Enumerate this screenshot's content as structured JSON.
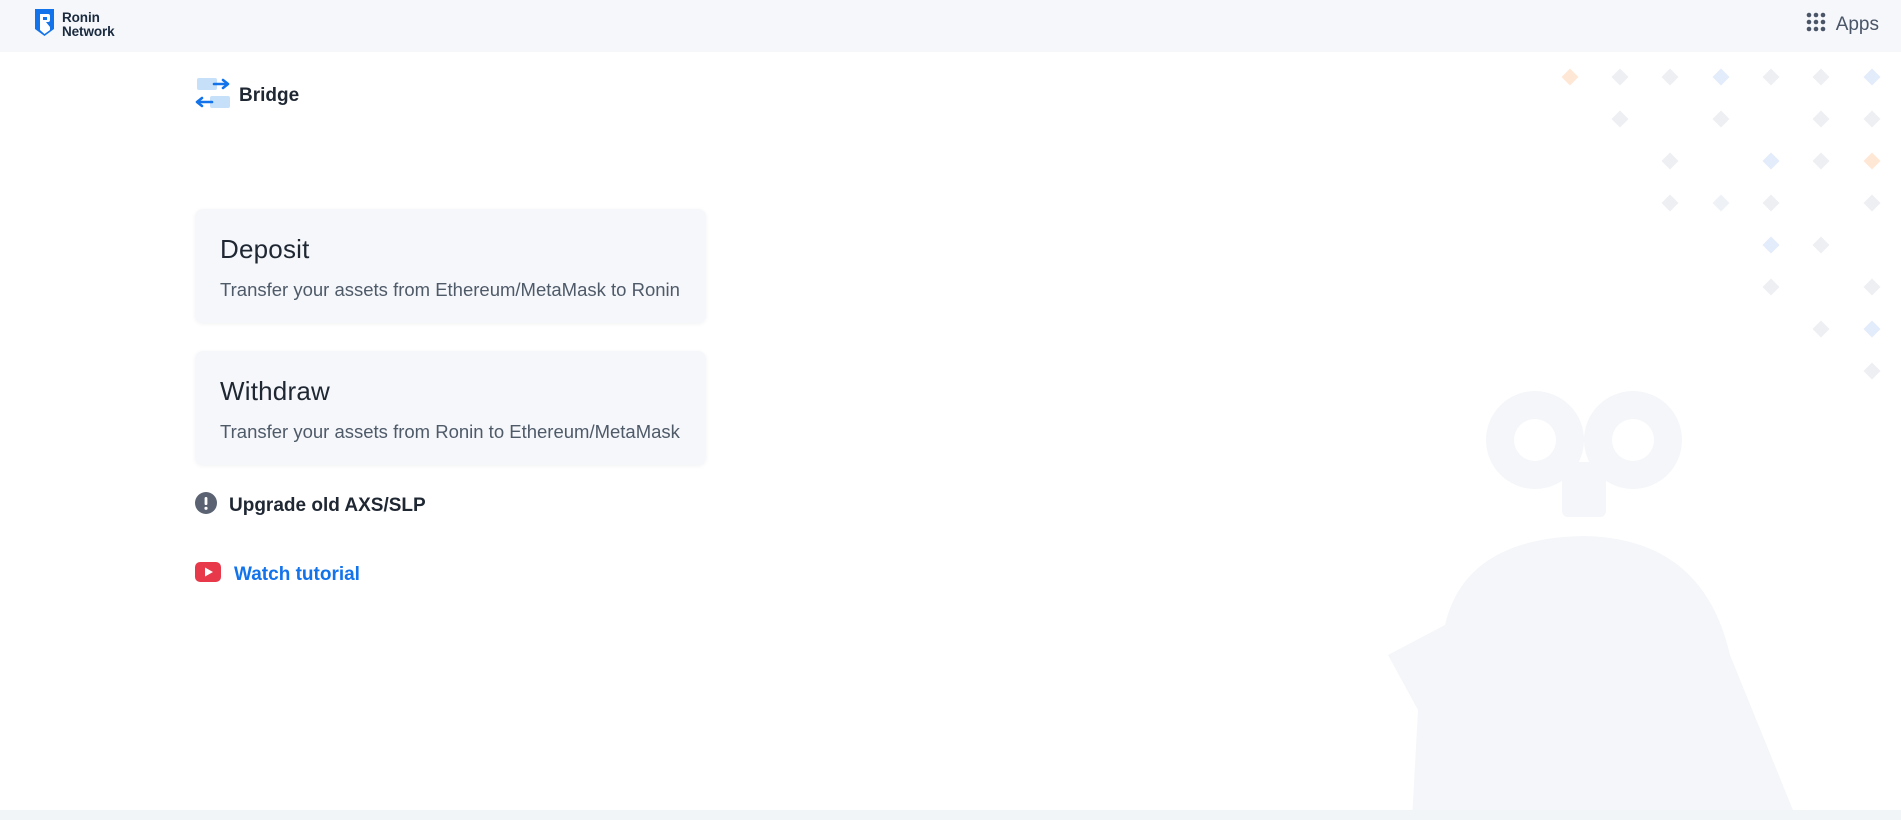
{
  "header": {
    "logo_line1": "Ronin",
    "logo_line2": "Network",
    "apps_label": "Apps"
  },
  "page": {
    "title": "Bridge"
  },
  "cards": {
    "deposit": {
      "title": "Deposit",
      "description": "Transfer your assets from Ethereum/MetaMask to Ronin"
    },
    "withdraw": {
      "title": "Withdraw",
      "description": "Transfer your assets from Ronin to Ethereum/MetaMask"
    }
  },
  "links": {
    "upgrade_label": "Upgrade old AXS/SLP",
    "tutorial_label": "Watch tutorial"
  },
  "icons": {
    "logo": "ronin-shield-icon",
    "apps": "grid-icon",
    "bridge": "swap-arrows-icon",
    "upgrade": "exclamation-circle-icon",
    "tutorial": "youtube-play-icon"
  },
  "colors": {
    "brand": "#1273ea",
    "text": "#1f2733",
    "muted": "#4f5a69",
    "card_bg": "#f5f7fa",
    "youtube": "#e8394b"
  }
}
